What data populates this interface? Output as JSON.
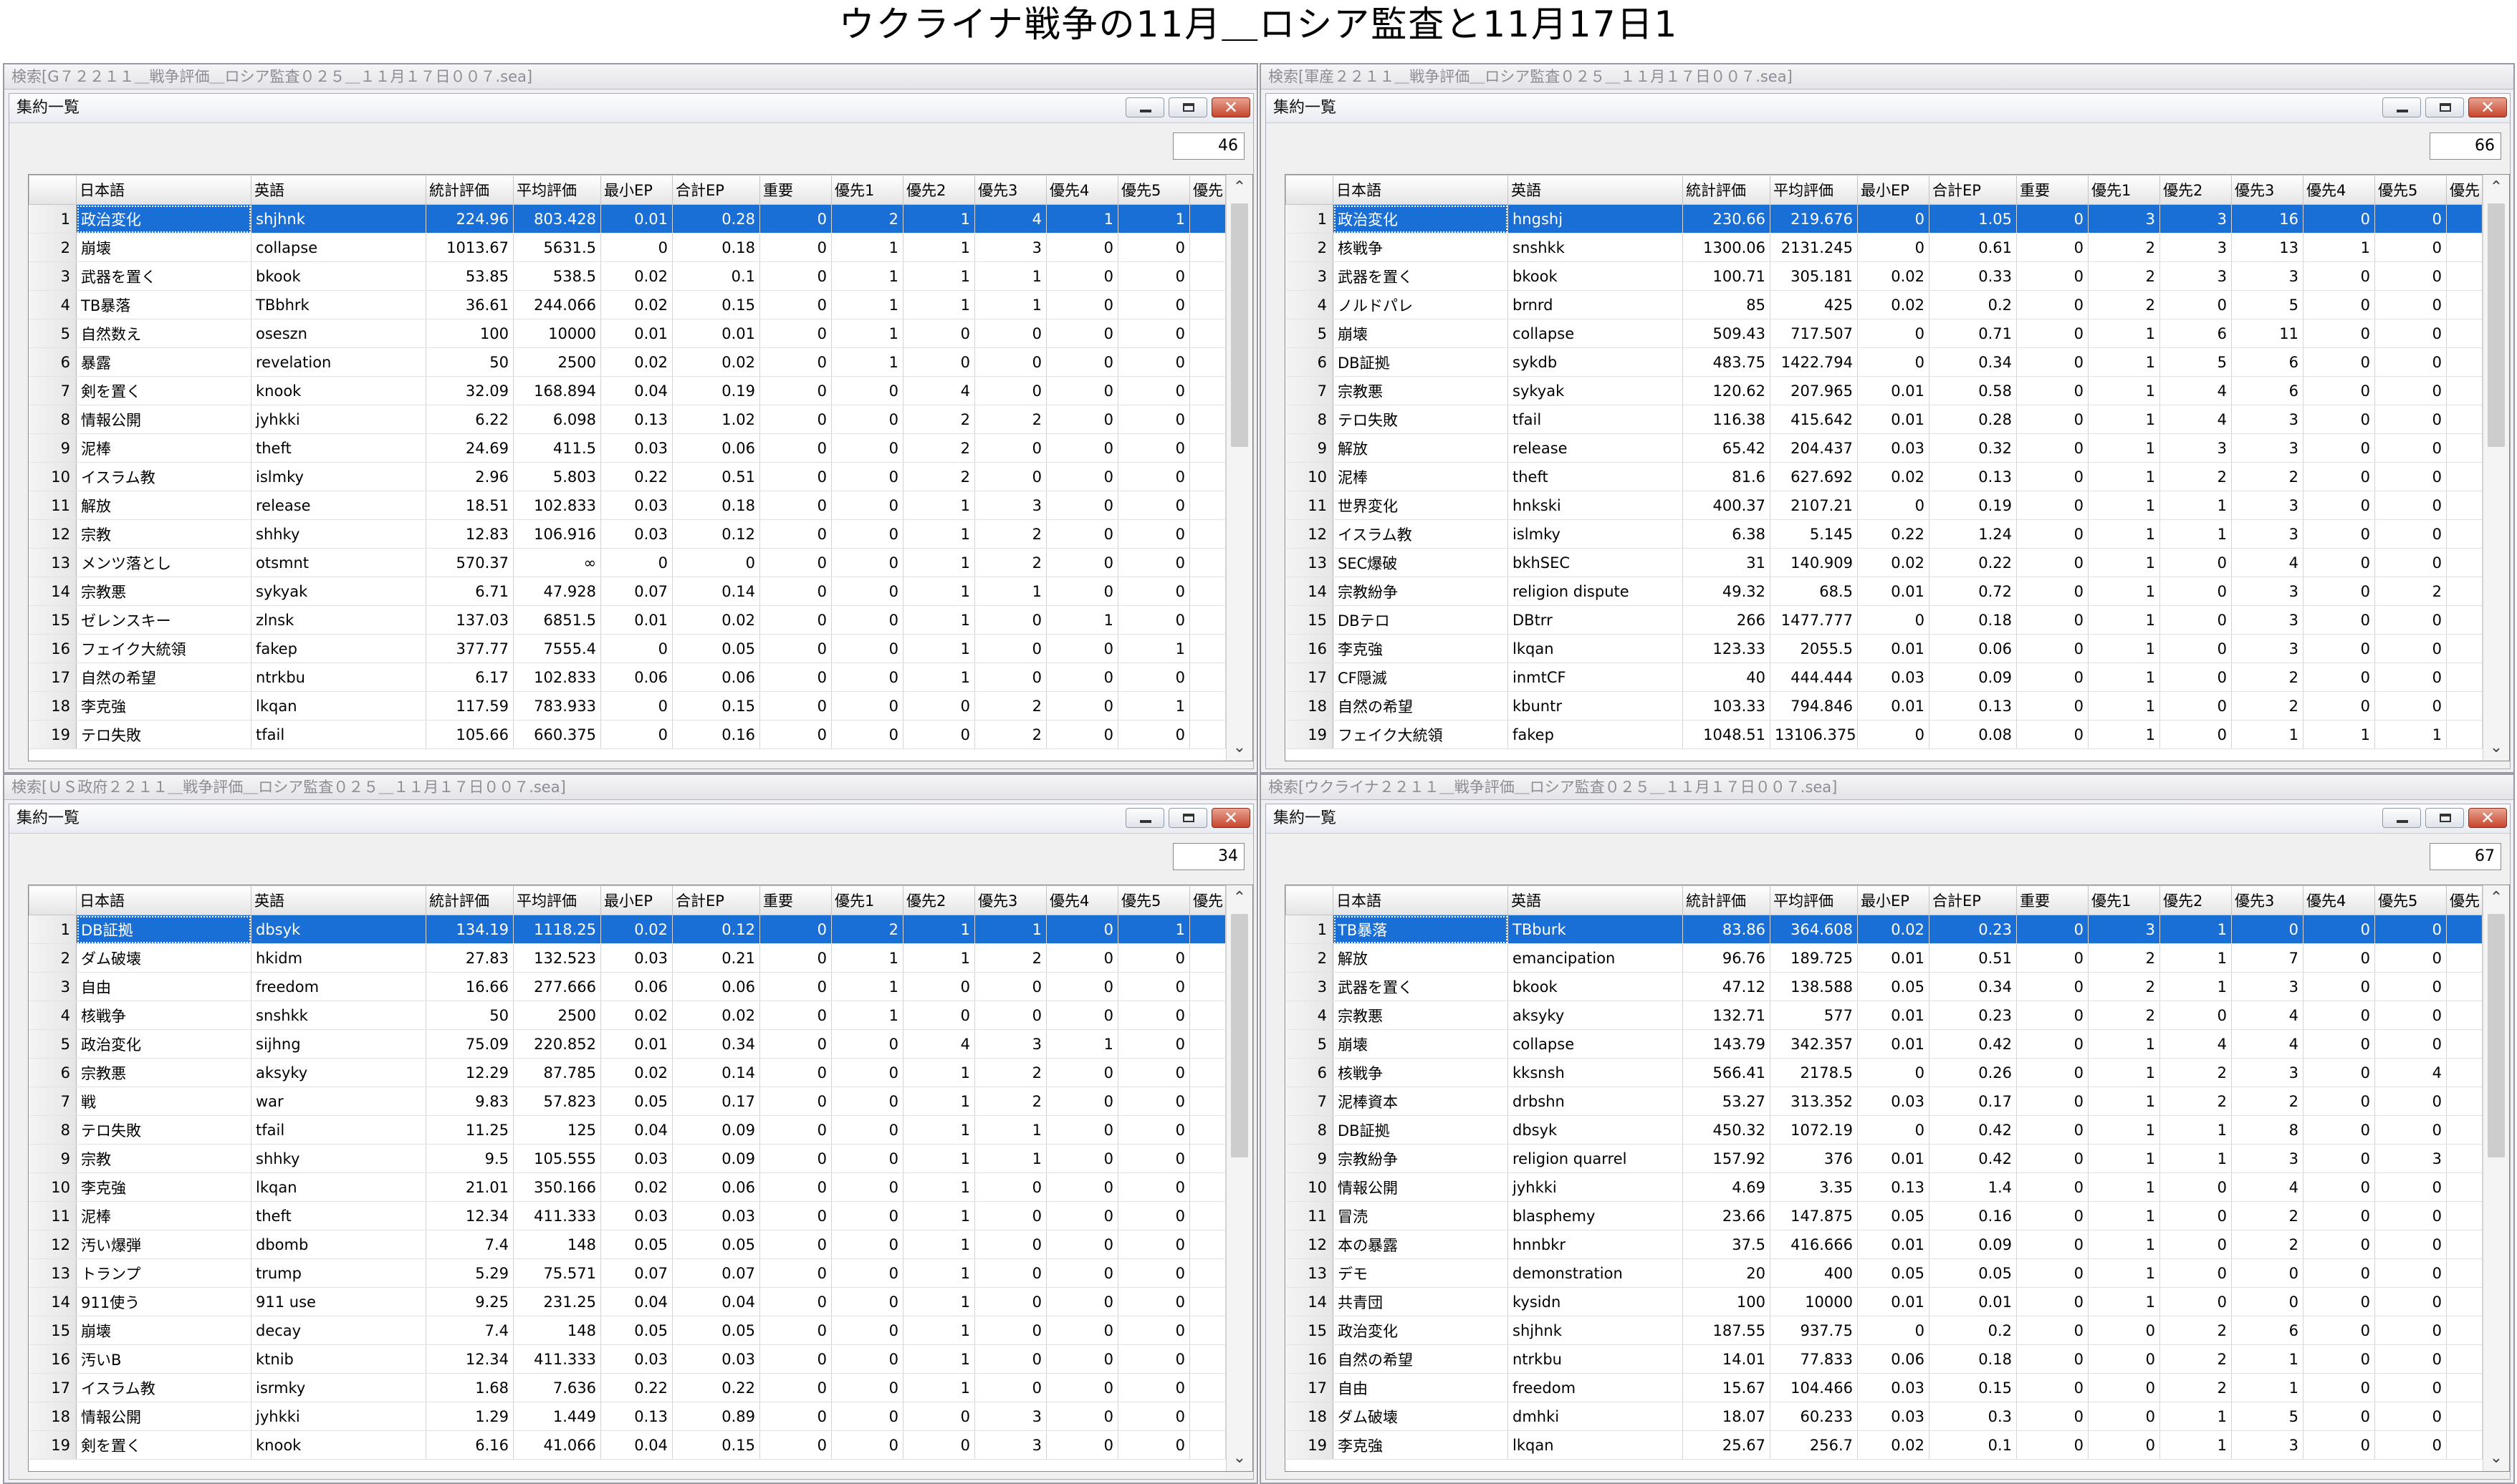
{
  "page_title": "ウクライナ戦争の11月＿ロシア監査と11月17日1",
  "columns": [
    "",
    "日本語",
    "英語",
    "統計評価",
    "平均評価",
    "最小EP",
    "合計EP",
    "重要",
    "優先1",
    "優先2",
    "優先3",
    "優先4",
    "優先5",
    "優先"
  ],
  "inner_title": "集約一覧",
  "icons": {
    "minimize": "minimize-icon",
    "maximize": "maximize-icon",
    "close": "close-icon",
    "scroll_up": "chevron-up-icon",
    "scroll_down": "chevron-down-icon"
  },
  "colors": {
    "selection": "#1a6fd6",
    "close_button": "#c7462c"
  },
  "panels": [
    {
      "outer_title": "検索[G７２２１１＿戦争評価＿ロシア監査０２５＿１１月１７日００７.sea]",
      "count": "46",
      "rows": [
        [
          "1",
          "政治変化",
          "shjhnk",
          "224.96",
          "803.428",
          "0.01",
          "0.28",
          "0",
          "2",
          "1",
          "4",
          "1",
          "1"
        ],
        [
          "2",
          "崩壊",
          "collapse",
          "1013.67",
          "5631.5",
          "0",
          "0.18",
          "0",
          "1",
          "1",
          "3",
          "0",
          "0"
        ],
        [
          "3",
          "武器を置く",
          "bkook",
          "53.85",
          "538.5",
          "0.02",
          "0.1",
          "0",
          "1",
          "1",
          "1",
          "0",
          "0"
        ],
        [
          "4",
          "TB暴落",
          "TBbhrk",
          "36.61",
          "244.066",
          "0.02",
          "0.15",
          "0",
          "1",
          "1",
          "1",
          "0",
          "0"
        ],
        [
          "5",
          "自然数え",
          "oseszn",
          "100",
          "10000",
          "0.01",
          "0.01",
          "0",
          "1",
          "0",
          "0",
          "0",
          "0"
        ],
        [
          "6",
          "暴露",
          "revelation",
          "50",
          "2500",
          "0.02",
          "0.02",
          "0",
          "1",
          "0",
          "0",
          "0",
          "0"
        ],
        [
          "7",
          "剣を置く",
          "knook",
          "32.09",
          "168.894",
          "0.04",
          "0.19",
          "0",
          "0",
          "4",
          "0",
          "0",
          "0"
        ],
        [
          "8",
          "情報公開",
          "jyhkki",
          "6.22",
          "6.098",
          "0.13",
          "1.02",
          "0",
          "0",
          "2",
          "2",
          "0",
          "0"
        ],
        [
          "9",
          "泥棒",
          "theft",
          "24.69",
          "411.5",
          "0.03",
          "0.06",
          "0",
          "0",
          "2",
          "0",
          "0",
          "0"
        ],
        [
          "10",
          "イスラム教",
          "islmky",
          "2.96",
          "5.803",
          "0.22",
          "0.51",
          "0",
          "0",
          "2",
          "0",
          "0",
          "0"
        ],
        [
          "11",
          "解放",
          "release",
          "18.51",
          "102.833",
          "0.03",
          "0.18",
          "0",
          "0",
          "1",
          "3",
          "0",
          "0"
        ],
        [
          "12",
          "宗教",
          "shhky",
          "12.83",
          "106.916",
          "0.03",
          "0.12",
          "0",
          "0",
          "1",
          "2",
          "0",
          "0"
        ],
        [
          "13",
          "メンツ落とし",
          "otsmnt",
          "570.37",
          "∞",
          "0",
          "0",
          "0",
          "0",
          "1",
          "2",
          "0",
          "0"
        ],
        [
          "14",
          "宗教悪",
          "sykyak",
          "6.71",
          "47.928",
          "0.07",
          "0.14",
          "0",
          "0",
          "1",
          "1",
          "0",
          "0"
        ],
        [
          "15",
          "ゼレンスキー",
          "zlnsk",
          "137.03",
          "6851.5",
          "0.01",
          "0.02",
          "0",
          "0",
          "1",
          "0",
          "1",
          "0"
        ],
        [
          "16",
          "フェイク大統領",
          "fakep",
          "377.77",
          "7555.4",
          "0",
          "0.05",
          "0",
          "0",
          "1",
          "0",
          "0",
          "1"
        ],
        [
          "17",
          "自然の希望",
          "ntrkbu",
          "6.17",
          "102.833",
          "0.06",
          "0.06",
          "0",
          "0",
          "1",
          "0",
          "0",
          "0"
        ],
        [
          "18",
          "李克強",
          "lkqan",
          "117.59",
          "783.933",
          "0",
          "0.15",
          "0",
          "0",
          "0",
          "2",
          "0",
          "1"
        ],
        [
          "19",
          "テロ失敗",
          "tfail",
          "105.66",
          "660.375",
          "0",
          "0.16",
          "0",
          "0",
          "0",
          "2",
          "0",
          "0"
        ]
      ]
    },
    {
      "outer_title": "検索[軍産２２１１＿戦争評価＿ロシア監査０２５＿１１月１７日００７.sea]",
      "count": "66",
      "rows": [
        [
          "1",
          "政治変化",
          "hngshj",
          "230.66",
          "219.676",
          "0",
          "1.05",
          "0",
          "3",
          "3",
          "16",
          "0",
          "0"
        ],
        [
          "2",
          "核戦争",
          "snshkk",
          "1300.06",
          "2131.245",
          "0",
          "0.61",
          "0",
          "2",
          "3",
          "13",
          "1",
          "0"
        ],
        [
          "3",
          "武器を置く",
          "bkook",
          "100.71",
          "305.181",
          "0.02",
          "0.33",
          "0",
          "2",
          "3",
          "3",
          "0",
          "0"
        ],
        [
          "4",
          "ノルドパレ",
          "brnrd",
          "85",
          "425",
          "0.02",
          "0.2",
          "0",
          "2",
          "0",
          "5",
          "0",
          "0"
        ],
        [
          "5",
          "崩壊",
          "collapse",
          "509.43",
          "717.507",
          "0",
          "0.71",
          "0",
          "1",
          "6",
          "11",
          "0",
          "0"
        ],
        [
          "6",
          "DB証拠",
          "sykdb",
          "483.75",
          "1422.794",
          "0",
          "0.34",
          "0",
          "1",
          "5",
          "6",
          "0",
          "0"
        ],
        [
          "7",
          "宗教悪",
          "sykyak",
          "120.62",
          "207.965",
          "0.01",
          "0.58",
          "0",
          "1",
          "4",
          "6",
          "0",
          "0"
        ],
        [
          "8",
          "テロ失敗",
          "tfail",
          "116.38",
          "415.642",
          "0.01",
          "0.28",
          "0",
          "1",
          "4",
          "3",
          "0",
          "0"
        ],
        [
          "9",
          "解放",
          "release",
          "65.42",
          "204.437",
          "0.03",
          "0.32",
          "0",
          "1",
          "3",
          "3",
          "0",
          "0"
        ],
        [
          "10",
          "泥棒",
          "theft",
          "81.6",
          "627.692",
          "0.02",
          "0.13",
          "0",
          "1",
          "2",
          "2",
          "0",
          "0"
        ],
        [
          "11",
          "世界変化",
          "hnkski",
          "400.37",
          "2107.21",
          "0",
          "0.19",
          "0",
          "1",
          "1",
          "3",
          "0",
          "0"
        ],
        [
          "12",
          "イスラム教",
          "islmky",
          "6.38",
          "5.145",
          "0.22",
          "1.24",
          "0",
          "1",
          "1",
          "3",
          "0",
          "0"
        ],
        [
          "13",
          "SEC爆破",
          "bkhSEC",
          "31",
          "140.909",
          "0.02",
          "0.22",
          "0",
          "1",
          "0",
          "4",
          "0",
          "0"
        ],
        [
          "14",
          "宗教紛争",
          "religion dispute",
          "49.32",
          "68.5",
          "0.01",
          "0.72",
          "0",
          "1",
          "0",
          "3",
          "0",
          "2"
        ],
        [
          "15",
          "DBテロ",
          "DBtrr",
          "266",
          "1477.777",
          "0",
          "0.18",
          "0",
          "1",
          "0",
          "3",
          "0",
          "0"
        ],
        [
          "16",
          "李克強",
          "lkqan",
          "123.33",
          "2055.5",
          "0.01",
          "0.06",
          "0",
          "1",
          "0",
          "3",
          "0",
          "0"
        ],
        [
          "17",
          "CF隠滅",
          "inmtCF",
          "40",
          "444.444",
          "0.03",
          "0.09",
          "0",
          "1",
          "0",
          "2",
          "0",
          "0"
        ],
        [
          "18",
          "自然の希望",
          "kbuntr",
          "103.33",
          "794.846",
          "0.01",
          "0.13",
          "0",
          "1",
          "0",
          "2",
          "0",
          "0"
        ],
        [
          "19",
          "フェイク大統領",
          "fakep",
          "1048.51",
          "13106.375",
          "0",
          "0.08",
          "0",
          "1",
          "0",
          "1",
          "1",
          "1"
        ]
      ]
    },
    {
      "outer_title": "検索[ＵＳ政府２２１１＿戦争評価＿ロシア監査０２５＿１１月１７日００７.sea]",
      "count": "34",
      "rows": [
        [
          "1",
          "DB証拠",
          "dbsyk",
          "134.19",
          "1118.25",
          "0.02",
          "0.12",
          "0",
          "2",
          "1",
          "1",
          "0",
          "1"
        ],
        [
          "2",
          "ダム破壊",
          "hkidm",
          "27.83",
          "132.523",
          "0.03",
          "0.21",
          "0",
          "1",
          "1",
          "2",
          "0",
          "0"
        ],
        [
          "3",
          "自由",
          "freedom",
          "16.66",
          "277.666",
          "0.06",
          "0.06",
          "0",
          "1",
          "0",
          "0",
          "0",
          "0"
        ],
        [
          "4",
          "核戦争",
          "snshkk",
          "50",
          "2500",
          "0.02",
          "0.02",
          "0",
          "1",
          "0",
          "0",
          "0",
          "0"
        ],
        [
          "5",
          "政治変化",
          "sijhng",
          "75.09",
          "220.852",
          "0.01",
          "0.34",
          "0",
          "0",
          "4",
          "3",
          "1",
          "0"
        ],
        [
          "6",
          "宗教悪",
          "aksyky",
          "12.29",
          "87.785",
          "0.02",
          "0.14",
          "0",
          "0",
          "1",
          "2",
          "0",
          "0"
        ],
        [
          "7",
          "戦",
          "war",
          "9.83",
          "57.823",
          "0.05",
          "0.17",
          "0",
          "0",
          "1",
          "2",
          "0",
          "0"
        ],
        [
          "8",
          "テロ失敗",
          "tfail",
          "11.25",
          "125",
          "0.04",
          "0.09",
          "0",
          "0",
          "1",
          "1",
          "0",
          "0"
        ],
        [
          "9",
          "宗教",
          "shhky",
          "9.5",
          "105.555",
          "0.03",
          "0.09",
          "0",
          "0",
          "1",
          "1",
          "0",
          "0"
        ],
        [
          "10",
          "李克強",
          "lkqan",
          "21.01",
          "350.166",
          "0.02",
          "0.06",
          "0",
          "0",
          "1",
          "0",
          "0",
          "0"
        ],
        [
          "11",
          "泥棒",
          "theft",
          "12.34",
          "411.333",
          "0.03",
          "0.03",
          "0",
          "0",
          "1",
          "0",
          "0",
          "0"
        ],
        [
          "12",
          "汚い爆弾",
          "dbomb",
          "7.4",
          "148",
          "0.05",
          "0.05",
          "0",
          "0",
          "1",
          "0",
          "0",
          "0"
        ],
        [
          "13",
          "トランプ",
          "trump",
          "5.29",
          "75.571",
          "0.07",
          "0.07",
          "0",
          "0",
          "1",
          "0",
          "0",
          "0"
        ],
        [
          "14",
          "911使う",
          "911 use",
          "9.25",
          "231.25",
          "0.04",
          "0.04",
          "0",
          "0",
          "1",
          "0",
          "0",
          "0"
        ],
        [
          "15",
          "崩壊",
          "decay",
          "7.4",
          "148",
          "0.05",
          "0.05",
          "0",
          "0",
          "1",
          "0",
          "0",
          "0"
        ],
        [
          "16",
          "汚いB",
          "ktnib",
          "12.34",
          "411.333",
          "0.03",
          "0.03",
          "0",
          "0",
          "1",
          "0",
          "0",
          "0"
        ],
        [
          "17",
          "イスラム教",
          "isrmky",
          "1.68",
          "7.636",
          "0.22",
          "0.22",
          "0",
          "0",
          "1",
          "0",
          "0",
          "0"
        ],
        [
          "18",
          "情報公開",
          "jyhkki",
          "1.29",
          "1.449",
          "0.13",
          "0.89",
          "0",
          "0",
          "0",
          "3",
          "0",
          "0"
        ],
        [
          "19",
          "剣を置く",
          "knook",
          "6.16",
          "41.066",
          "0.04",
          "0.15",
          "0",
          "0",
          "0",
          "3",
          "0",
          "0"
        ]
      ]
    },
    {
      "outer_title": "検索[ウクライナ２２１１＿戦争評価＿ロシア監査０２５＿１１月１７日００７.sea]",
      "count": "67",
      "rows": [
        [
          "1",
          "TB暴落",
          "TBburk",
          "83.86",
          "364.608",
          "0.02",
          "0.23",
          "0",
          "3",
          "1",
          "0",
          "0",
          "0"
        ],
        [
          "2",
          "解放",
          "emancipation",
          "96.76",
          "189.725",
          "0.01",
          "0.51",
          "0",
          "2",
          "1",
          "7",
          "0",
          "0"
        ],
        [
          "3",
          "武器を置く",
          "bkook",
          "47.12",
          "138.588",
          "0.05",
          "0.34",
          "0",
          "2",
          "1",
          "3",
          "0",
          "0"
        ],
        [
          "4",
          "宗教悪",
          "aksyky",
          "132.71",
          "577",
          "0.01",
          "0.23",
          "0",
          "2",
          "0",
          "4",
          "0",
          "0"
        ],
        [
          "5",
          "崩壊",
          "collapse",
          "143.79",
          "342.357",
          "0.01",
          "0.42",
          "0",
          "1",
          "4",
          "4",
          "0",
          "0"
        ],
        [
          "6",
          "核戦争",
          "kksnsh",
          "566.41",
          "2178.5",
          "0",
          "0.26",
          "0",
          "1",
          "2",
          "3",
          "0",
          "4"
        ],
        [
          "7",
          "泥棒資本",
          "drbshn",
          "53.27",
          "313.352",
          "0.03",
          "0.17",
          "0",
          "1",
          "2",
          "2",
          "0",
          "0"
        ],
        [
          "8",
          "DB証拠",
          "dbsyk",
          "450.32",
          "1072.19",
          "0",
          "0.42",
          "0",
          "1",
          "1",
          "8",
          "0",
          "0"
        ],
        [
          "9",
          "宗教紛争",
          "religion quarrel",
          "157.92",
          "376",
          "0.01",
          "0.42",
          "0",
          "1",
          "1",
          "3",
          "0",
          "3"
        ],
        [
          "10",
          "情報公開",
          "jyhkki",
          "4.69",
          "3.35",
          "0.13",
          "1.4",
          "0",
          "1",
          "0",
          "4",
          "0",
          "0"
        ],
        [
          "11",
          "冒涜",
          "blasphemy",
          "23.66",
          "147.875",
          "0.05",
          "0.16",
          "0",
          "1",
          "0",
          "2",
          "0",
          "0"
        ],
        [
          "12",
          "本の暴露",
          "hnnbkr",
          "37.5",
          "416.666",
          "0.01",
          "0.09",
          "0",
          "1",
          "0",
          "2",
          "0",
          "0"
        ],
        [
          "13",
          "デモ",
          "demonstration",
          "20",
          "400",
          "0.05",
          "0.05",
          "0",
          "1",
          "0",
          "0",
          "0",
          "0"
        ],
        [
          "14",
          "共青団",
          "kysidn",
          "100",
          "10000",
          "0.01",
          "0.01",
          "0",
          "1",
          "0",
          "0",
          "0",
          "0"
        ],
        [
          "15",
          "政治変化",
          "shjhnk",
          "187.55",
          "937.75",
          "0",
          "0.2",
          "0",
          "0",
          "2",
          "6",
          "0",
          "0"
        ],
        [
          "16",
          "自然の希望",
          "ntrkbu",
          "14.01",
          "77.833",
          "0.06",
          "0.18",
          "0",
          "0",
          "2",
          "1",
          "0",
          "0"
        ],
        [
          "17",
          "自由",
          "freedom",
          "15.67",
          "104.466",
          "0.03",
          "0.15",
          "0",
          "0",
          "2",
          "1",
          "0",
          "0"
        ],
        [
          "18",
          "ダム破壊",
          "dmhki",
          "18.07",
          "60.233",
          "0.03",
          "0.3",
          "0",
          "0",
          "1",
          "5",
          "0",
          "0"
        ],
        [
          "19",
          "李克強",
          "lkqan",
          "25.67",
          "256.7",
          "0.02",
          "0.1",
          "0",
          "0",
          "1",
          "3",
          "0",
          "0"
        ]
      ]
    }
  ]
}
